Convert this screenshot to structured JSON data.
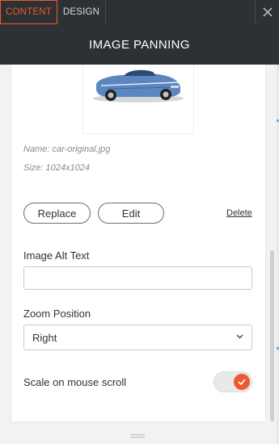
{
  "tabs": [
    {
      "label": "CONTENT",
      "active": true
    },
    {
      "label": "DESIGN",
      "active": false
    }
  ],
  "header": {
    "title": "IMAGE PANNING"
  },
  "image": {
    "name_line": "Name: car-original.jpg",
    "size_line": "Size: 1024x1024"
  },
  "actions": {
    "replace_label": "Replace",
    "edit_label": "Edit",
    "delete_label": "Delete"
  },
  "alt_text": {
    "label": "Image Alt Text",
    "value": "",
    "placeholder": ""
  },
  "zoom_position": {
    "label": "Zoom Position",
    "selected": "Right"
  },
  "scale_on_scroll": {
    "label": "Scale on mouse scroll",
    "enabled": true
  },
  "colors": {
    "accent": "#ee5a2f",
    "header_bg": "#2e3133",
    "panel_bg": "#f2f2f2"
  },
  "icons": [
    "close-icon",
    "chevron-down-icon",
    "checkmark-icon",
    "drag-handle-icon"
  ]
}
